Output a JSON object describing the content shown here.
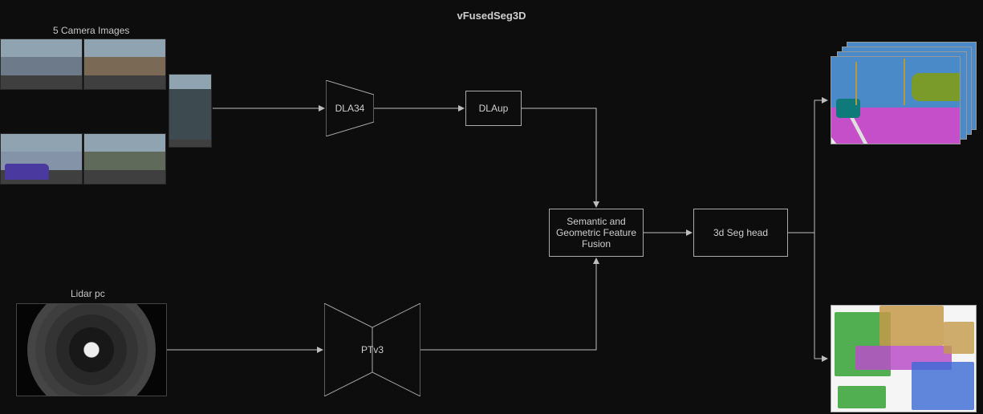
{
  "title": "vFusedSeg3D",
  "inputs": {
    "camera_label": "5 Camera Images",
    "lidar_label": "Lidar pc"
  },
  "blocks": {
    "dla34": "DLA34",
    "dlaup": "DLAup",
    "ptv3": "PTv3",
    "fusion": "Semantic and Geometric Feature Fusion",
    "seg_head": "3d Seg head"
  },
  "outputs": {
    "camera_seg": "camera-segmentation-output",
    "lidar_seg": "lidar-segmentation-output"
  }
}
